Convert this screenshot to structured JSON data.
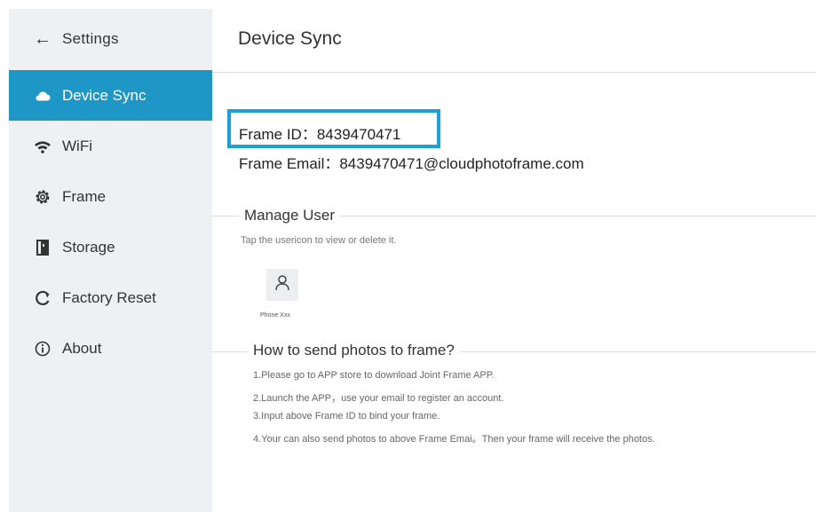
{
  "sidebar": {
    "header": {
      "label": "Settings",
      "icon": "back-arrow-icon"
    },
    "items": [
      {
        "label": "Device Sync",
        "icon": "cloud-icon",
        "active": true
      },
      {
        "label": "WiFi",
        "icon": "wifi-icon",
        "active": false
      },
      {
        "label": "Frame",
        "icon": "gear-icon",
        "active": false
      },
      {
        "label": "Storage",
        "icon": "storage-icon",
        "active": false
      },
      {
        "label": "Factory Reset",
        "icon": "reset-icon",
        "active": false
      },
      {
        "label": "About",
        "icon": "info-icon",
        "active": false
      }
    ]
  },
  "main": {
    "title": "Device Sync",
    "frame_id": "Frame ID：8439470471",
    "frame_email": "Frame Email：8439470471@cloudphotoframe.com",
    "manage_user": {
      "title": "Manage User",
      "hint": "Tap the usericon to view or delete it.",
      "users": [
        {
          "name": "Phone Xxx"
        }
      ]
    },
    "how_to": {
      "title": "How to send photos to frame?",
      "steps": [
        "1.Please go to APP store to download Joint Frame APP.",
        "2.Launch the APP，use your email to register an account.",
        "3.Input above Frame ID to bind your frame.",
        "4.Your can also send photos to above Frame Emai。Then your frame will receive the photos."
      ]
    }
  },
  "colors": {
    "sidebar_bg": "#eff0f3",
    "active_bg": "#1e97c7",
    "highlight_border": "#1ba1d8"
  }
}
